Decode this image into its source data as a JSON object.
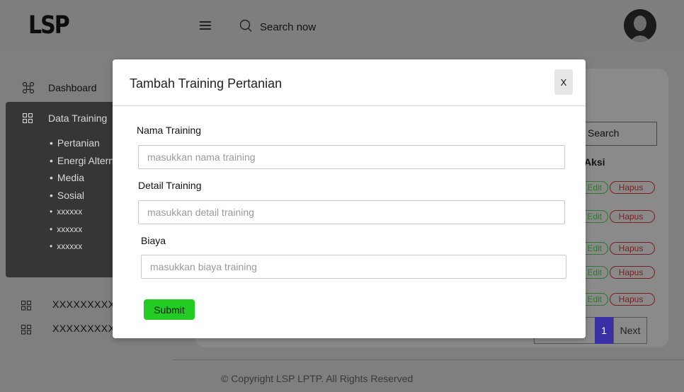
{
  "header": {
    "logo": "LSP",
    "search_placeholder": "Search now"
  },
  "sidebar": {
    "dashboard_label": "Dashboard",
    "section_title": "Data Training",
    "items": [
      "Pertanian",
      "Energi Alternatif",
      "Media",
      "Sosial",
      "xxxxxx",
      "xxxxxx",
      "xxxxxx"
    ],
    "extra_items": [
      "XXXXXXXXX",
      "XXXXXXXXX"
    ]
  },
  "main": {
    "search_label": "Search",
    "column_aksi": "Aksi",
    "edit_label": "Edit",
    "delete_label": "Hapus",
    "pagination": {
      "current": "1",
      "next": "Next"
    }
  },
  "footer": {
    "text": "© Copyright LSP LPTP. All Rights Reserved"
  },
  "modal": {
    "title": "Tambah Training Pertanian",
    "close_label": "X",
    "fields": [
      {
        "label": "Nama Training",
        "placeholder": "masukkan nama training"
      },
      {
        "label": "Detail Training",
        "placeholder": "masukkan detail training"
      },
      {
        "label": "Biaya",
        "placeholder": "masukkan biaya training"
      }
    ],
    "submit_label": "Submit"
  },
  "colors": {
    "overlay": "#7f7f7f",
    "sidebar_panel": "#363636",
    "submit": "#22cc22",
    "pagination_active": "#3a2fa5"
  }
}
